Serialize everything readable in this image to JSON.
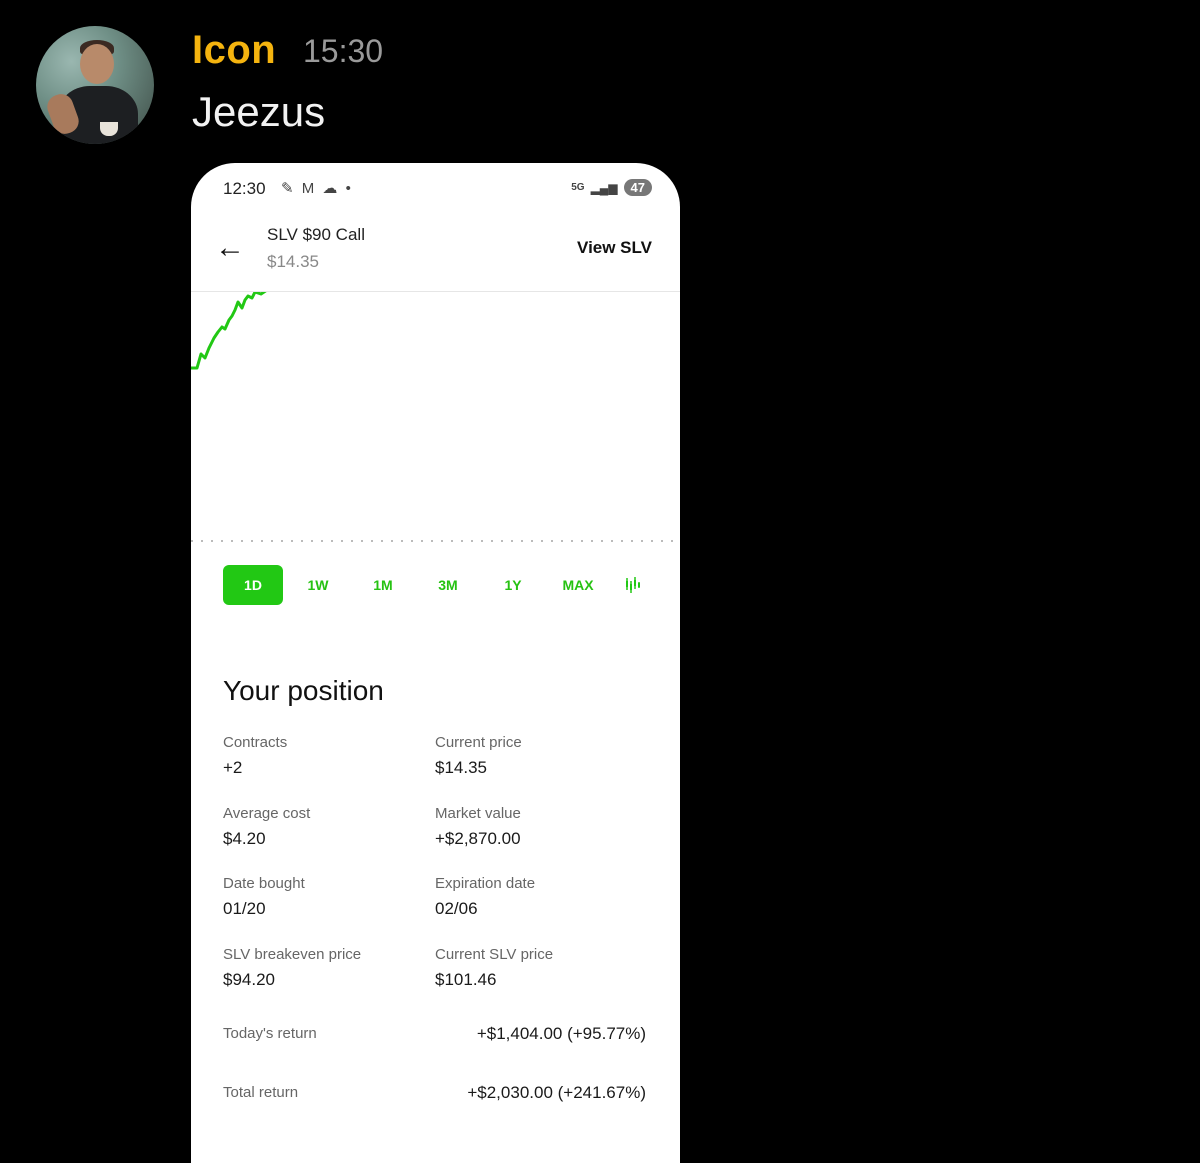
{
  "chat": {
    "username": "Icon",
    "time": "15:30",
    "message": "Jeezus"
  },
  "phone": {
    "status": {
      "time": "12:30",
      "icons": "✎ M ☁ •",
      "network": "5G",
      "battery": "47"
    },
    "header": {
      "title": "SLV $90 Call",
      "price": "$14.35",
      "view_link": "View SLV"
    },
    "ranges": [
      "1D",
      "1W",
      "1M",
      "3M",
      "1Y",
      "MAX"
    ],
    "active_range": "1D",
    "colors": {
      "accent": "#22c814",
      "username": "#f5b40f"
    },
    "position": {
      "title": "Your position",
      "fields": [
        {
          "label": "Contracts",
          "value": "+2"
        },
        {
          "label": "Current price",
          "value": "$14.35"
        },
        {
          "label": "Average cost",
          "value": "$4.20"
        },
        {
          "label": "Market value",
          "value": "+$2,870.00"
        },
        {
          "label": "Date bought",
          "value": "01/20"
        },
        {
          "label": "Expiration date",
          "value": "02/06"
        },
        {
          "label": "SLV breakeven price",
          "value": "$94.20"
        },
        {
          "label": "Current SLV price",
          "value": "$101.46"
        }
      ],
      "returns": [
        {
          "label": "Today's return",
          "value": "+$1,404.00 (+95.77%)"
        },
        {
          "label": "Total return",
          "value": "+$2,030.00 (+241.67%)"
        }
      ]
    }
  }
}
